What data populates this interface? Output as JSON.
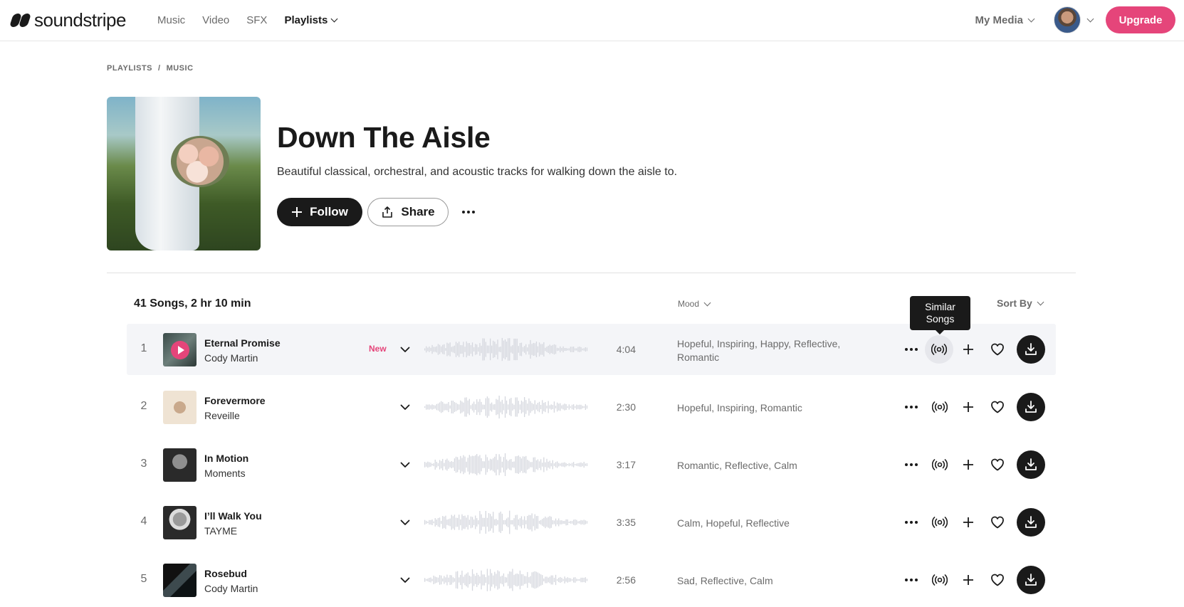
{
  "brand": {
    "name": "soundstripe",
    "accent": "#e5457a"
  },
  "nav": {
    "items": [
      {
        "label": "Music",
        "active": false
      },
      {
        "label": "Video",
        "active": false
      },
      {
        "label": "SFX",
        "active": false
      },
      {
        "label": "Playlists",
        "active": true
      }
    ],
    "my_media": "My Media",
    "upgrade": "Upgrade"
  },
  "breadcrumb": {
    "first": "PLAYLISTS",
    "separator": "/",
    "second": "MUSIC"
  },
  "playlist": {
    "title": "Down The Aisle",
    "description": "Beautiful classical, orchestral, and acoustic tracks for walking down the aisle to.",
    "follow_label": "Follow",
    "share_label": "Share"
  },
  "list": {
    "summary": "41 Songs, 2 hr 10 min",
    "mood_filter": "Mood",
    "sort_label": "Sort By",
    "tooltip": {
      "line1": "Similar",
      "line2": "Songs"
    }
  },
  "songs": [
    {
      "number": "1",
      "title": "Eternal Promise",
      "artist": "Cody Martin",
      "badge": "New",
      "duration": "4:04",
      "moods_line1": "Hopeful, Inspiring, Happy, Reflective,",
      "moods_line2": "Romantic",
      "playing": true
    },
    {
      "number": "2",
      "title": "Forevermore",
      "artist": "Reveille",
      "badge": "",
      "duration": "2:30",
      "moods_line1": "Hopeful, Inspiring, Romantic",
      "moods_line2": ""
    },
    {
      "number": "3",
      "title": "In Motion",
      "artist": "Moments",
      "badge": "",
      "duration": "3:17",
      "moods_line1": "Romantic, Reflective, Calm",
      "moods_line2": ""
    },
    {
      "number": "4",
      "title": "I’ll Walk You",
      "artist": "TAYME",
      "badge": "",
      "duration": "3:35",
      "moods_line1": "Calm, Hopeful, Reflective",
      "moods_line2": ""
    },
    {
      "number": "5",
      "title": "Rosebud",
      "artist": "Cody Martin",
      "badge": "",
      "duration": "2:56",
      "moods_line1": "Sad, Reflective, Calm",
      "moods_line2": ""
    }
  ],
  "icons": [
    "play-icon",
    "chevron-down-icon",
    "more-horizontal-icon",
    "similar-songs-icon",
    "plus-icon",
    "heart-icon",
    "download-icon",
    "share-icon"
  ]
}
